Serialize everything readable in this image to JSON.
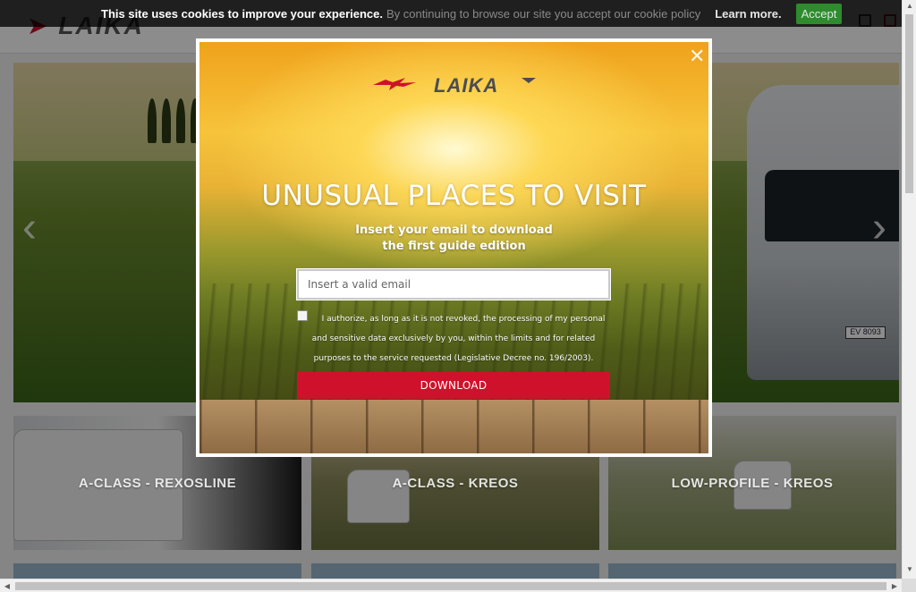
{
  "cookie_bar": {
    "strong_text": "This site uses cookies to improve your experience.",
    "soft_text": "By continuing to browse our site you accept our cookie policy",
    "learn_more": "Learn more.",
    "accept": "Accept"
  },
  "page": {
    "tiles": [
      {
        "label": "A-CLASS - REXOSLINE"
      },
      {
        "label": "A-CLASS - KREOS"
      },
      {
        "label": "LOW-PROFILE - KREOS"
      }
    ],
    "hero_prev_icon": "chevron-left-icon",
    "hero_next_icon": "chevron-right-icon",
    "plate_text": "EV 8093"
  },
  "modal": {
    "close_icon": "close-icon",
    "logo_text": "LAIKA",
    "title": "UNUSUAL PLACES TO VISIT",
    "subtitle_line1": "Insert your email to download",
    "subtitle_line2": "the first guide edition",
    "email_placeholder": "Insert a valid email",
    "email_value": "",
    "consent_text": "I authorize, as long as it is not revoked, the processing of my personal and sensitive data exclusively by you, within the limits and for related purposes to the service requested (Legislative Decree no. 196/2003).",
    "consent_checked": false,
    "download_label": "DOWNLOAD"
  },
  "colors": {
    "brand_red": "#d0112b",
    "accept_green": "#2e8b2e",
    "cookie_bg": "#000000"
  }
}
